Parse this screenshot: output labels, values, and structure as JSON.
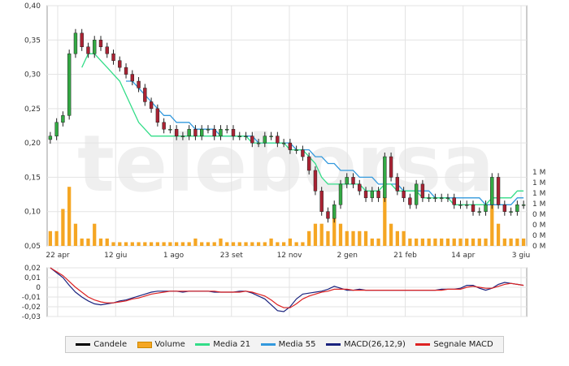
{
  "chart_data": [
    {
      "type": "candlestick",
      "watermark": "teleborsa",
      "price_axis": {
        "ylim": [
          0.05,
          0.4
        ],
        "ticks": [
          "0,40",
          "0,35",
          "0,30",
          "0,25",
          "0,20",
          "0,15",
          "0,10",
          "0,05"
        ]
      },
      "volume_axis": {
        "ticks": [
          "1 M",
          "1 M",
          "1 M",
          "1 M",
          "0 M",
          "0 M",
          "0 M",
          "0 M"
        ]
      },
      "x_labels": [
        "22 apr",
        "12 giu",
        "1 ago",
        "23 set",
        "12 nov",
        "2 gen",
        "21 feb",
        "14 apr",
        "3 giu"
      ],
      "series": [
        {
          "name": "Candele",
          "color": "#000000",
          "close": [
            0.21,
            0.23,
            0.24,
            0.33,
            0.36,
            0.34,
            0.33,
            0.35,
            0.34,
            0.33,
            0.32,
            0.31,
            0.3,
            0.29,
            0.28,
            0.26,
            0.25,
            0.23,
            0.22,
            0.22,
            0.21,
            0.21,
            0.22,
            0.21,
            0.22,
            0.22,
            0.21,
            0.22,
            0.22,
            0.21,
            0.21,
            0.21,
            0.2,
            0.2,
            0.21,
            0.21,
            0.2,
            0.2,
            0.19,
            0.19,
            0.18,
            0.16,
            0.13,
            0.1,
            0.09,
            0.11,
            0.14,
            0.15,
            0.14,
            0.13,
            0.12,
            0.13,
            0.12,
            0.18,
            0.15,
            0.13,
            0.12,
            0.11,
            0.14,
            0.12,
            0.12,
            0.12,
            0.12,
            0.12,
            0.11,
            0.11,
            0.11,
            0.1,
            0.1,
            0.11,
            0.15,
            0.11,
            0.1,
            0.1,
            0.11,
            0.11
          ]
        },
        {
          "name": "Volume",
          "color": "#f5a623",
          "unit": "M",
          "values": [
            0.2,
            0.2,
            0.5,
            0.8,
            0.3,
            0.1,
            0.1,
            0.3,
            0.1,
            0.1,
            0.05,
            0.05,
            0.05,
            0.05,
            0.05,
            0.05,
            0.05,
            0.05,
            0.05,
            0.05,
            0.05,
            0.05,
            0.05,
            0.1,
            0.05,
            0.05,
            0.05,
            0.1,
            0.05,
            0.05,
            0.05,
            0.05,
            0.05,
            0.05,
            0.05,
            0.1,
            0.05,
            0.05,
            0.1,
            0.05,
            0.05,
            0.2,
            0.3,
            0.3,
            0.2,
            0.5,
            0.3,
            0.2,
            0.2,
            0.2,
            0.2,
            0.1,
            0.1,
            0.7,
            0.3,
            0.2,
            0.2,
            0.1,
            0.1,
            0.1,
            0.1,
            0.1,
            0.1,
            0.1,
            0.1,
            0.1,
            0.1,
            0.1,
            0.1,
            0.1,
            0.8,
            0.3,
            0.1,
            0.1,
            0.1,
            0.1
          ]
        },
        {
          "name": "Media 21",
          "color": "#33dd88",
          "values": [
            null,
            null,
            null,
            null,
            null,
            0.31,
            0.33,
            0.33,
            0.32,
            0.31,
            0.3,
            0.29,
            0.27,
            0.25,
            0.23,
            0.22,
            0.21,
            0.21,
            0.21,
            0.21,
            0.21,
            0.21,
            0.21,
            0.21,
            0.21,
            0.21,
            0.21,
            0.21,
            0.21,
            0.21,
            0.21,
            0.21,
            0.2,
            0.2,
            0.2,
            0.2,
            0.2,
            0.2,
            0.19,
            0.19,
            0.19,
            0.18,
            0.17,
            0.15,
            0.14,
            0.14,
            0.14,
            0.14,
            0.14,
            0.14,
            0.13,
            0.13,
            0.13,
            0.14,
            0.14,
            0.13,
            0.13,
            0.13,
            0.13,
            0.12,
            0.12,
            0.12,
            0.12,
            0.12,
            0.11,
            0.11,
            0.11,
            0.11,
            0.11,
            0.11,
            0.12,
            0.12,
            0.12,
            0.12,
            0.13,
            0.13
          ]
        },
        {
          "name": "Media 55",
          "color": "#3399dd",
          "values": [
            null,
            null,
            null,
            null,
            null,
            null,
            null,
            null,
            null,
            null,
            null,
            null,
            0.29,
            0.29,
            0.28,
            0.27,
            0.26,
            0.25,
            0.24,
            0.24,
            0.23,
            0.23,
            0.23,
            0.22,
            0.22,
            0.22,
            0.22,
            0.21,
            0.21,
            0.21,
            0.21,
            0.21,
            0.21,
            0.2,
            0.2,
            0.2,
            0.2,
            0.2,
            0.2,
            0.19,
            0.19,
            0.19,
            0.18,
            0.18,
            0.17,
            0.17,
            0.16,
            0.16,
            0.16,
            0.15,
            0.15,
            0.15,
            0.14,
            0.14,
            0.14,
            0.14,
            0.13,
            0.13,
            0.13,
            0.13,
            0.13,
            0.12,
            0.12,
            0.12,
            0.12,
            0.12,
            0.12,
            0.12,
            0.12,
            0.11,
            0.11,
            0.11,
            0.11,
            0.11,
            0.12,
            0.12
          ]
        }
      ]
    },
    {
      "type": "line",
      "ylim": [
        -0.03,
        0.02
      ],
      "ticks": [
        "0,02",
        "0,01",
        "0",
        "-0,01",
        "-0,02",
        "-0,03"
      ],
      "series": [
        {
          "name": "MACD(26,12,9)",
          "color": "#1a237e",
          "values": [
            0.02,
            0.015,
            0.01,
            0.002,
            -0.005,
            -0.01,
            -0.014,
            -0.017,
            -0.018,
            -0.017,
            -0.016,
            -0.014,
            -0.013,
            -0.011,
            -0.009,
            -0.007,
            -0.005,
            -0.004,
            -0.004,
            -0.004,
            -0.004,
            -0.005,
            -0.004,
            -0.004,
            -0.004,
            -0.004,
            -0.005,
            -0.005,
            -0.005,
            -0.005,
            -0.004,
            -0.004,
            -0.006,
            -0.009,
            -0.012,
            -0.018,
            -0.024,
            -0.025,
            -0.02,
            -0.012,
            -0.007,
            -0.006,
            -0.005,
            -0.004,
            -0.002,
            0.001,
            -0.001,
            -0.003,
            -0.003,
            -0.002,
            -0.003,
            -0.003,
            -0.003,
            -0.003,
            -0.003,
            -0.003,
            -0.003,
            -0.003,
            -0.003,
            -0.003,
            -0.003,
            -0.003,
            -0.002,
            -0.002,
            -0.002,
            -0.001,
            0.002,
            0.002,
            -0.001,
            -0.003,
            -0.001,
            0.003,
            0.005,
            0.004,
            0.003,
            0.002
          ]
        },
        {
          "name": "Segnale MACD",
          "color": "#dd2222",
          "values": [
            0.02,
            0.016,
            0.012,
            0.006,
            0.0,
            -0.005,
            -0.01,
            -0.013,
            -0.015,
            -0.016,
            -0.016,
            -0.015,
            -0.014,
            -0.012,
            -0.011,
            -0.009,
            -0.007,
            -0.006,
            -0.005,
            -0.004,
            -0.004,
            -0.004,
            -0.004,
            -0.004,
            -0.004,
            -0.004,
            -0.004,
            -0.005,
            -0.005,
            -0.005,
            -0.005,
            -0.004,
            -0.005,
            -0.007,
            -0.009,
            -0.013,
            -0.018,
            -0.021,
            -0.021,
            -0.017,
            -0.012,
            -0.009,
            -0.007,
            -0.005,
            -0.004,
            -0.002,
            -0.002,
            -0.002,
            -0.003,
            -0.003,
            -0.003,
            -0.003,
            -0.003,
            -0.003,
            -0.003,
            -0.003,
            -0.003,
            -0.003,
            -0.003,
            -0.003,
            -0.003,
            -0.003,
            -0.003,
            -0.002,
            -0.002,
            -0.002,
            0.0,
            0.001,
            0.0,
            -0.001,
            -0.001,
            0.001,
            0.003,
            0.004,
            0.003,
            0.002
          ]
        }
      ]
    }
  ],
  "legend": [
    {
      "label": "Candele",
      "color": "#000000",
      "kind": "line"
    },
    {
      "label": "Volume",
      "color": "#f5a623",
      "kind": "box"
    },
    {
      "label": "Media 21",
      "color": "#33dd88",
      "kind": "line"
    },
    {
      "label": "Media 55",
      "color": "#3399dd",
      "kind": "line"
    },
    {
      "label": "MACD(26,12,9)",
      "color": "#1a237e",
      "kind": "line"
    },
    {
      "label": "Segnale MACD",
      "color": "#dd2222",
      "kind": "line"
    }
  ]
}
